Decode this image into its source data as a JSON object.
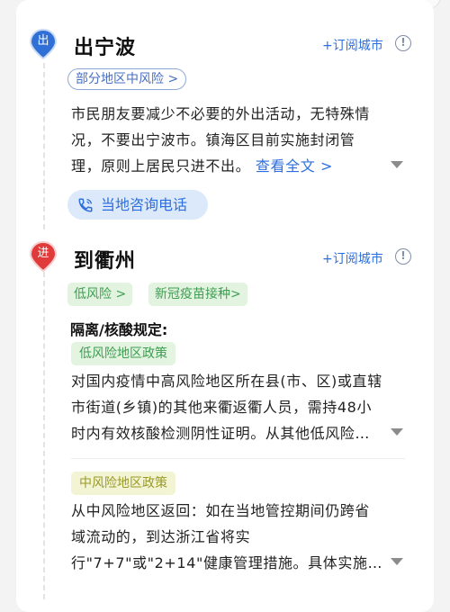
{
  "section1": {
    "badge": "出",
    "badge_color": "#2f6fd6",
    "title": "出宁波",
    "subscribe_label": "+订阅城市",
    "info_icon": "info-icon",
    "risk_tag": "部分地区中风险 >",
    "text_lines": [
      "市民朋友要减少不必要的外出活动，无特殊情",
      "况，不要出宁波市。镇海区目前实施封闭管",
      "理，原则上居民只进不出。"
    ],
    "view_full": "查看全文 >",
    "phone_button": "当地咨询电话",
    "phone_icon": "phone-icon"
  },
  "section2": {
    "badge": "进",
    "badge_color": "#e03a3a",
    "title": "到衢州",
    "subscribe_label": "+订阅城市",
    "info_icon": "info-icon",
    "tags": [
      "低风险 >",
      "新冠疫苗接种>"
    ],
    "rules_heading": "隔离/核酸规定:",
    "policies": [
      {
        "label": "低风险地区政策",
        "label_color": "#3f9d52",
        "lines": [
          "对国内疫情中高风险地区所在县(市、区)或直辖",
          "市街道(乡镇)的其他来衢返衢人员，需持48小",
          "时内有效核酸检测阴性证明。从其他低风险…"
        ]
      },
      {
        "label": "中风险地区政策",
        "label_color": "#9a9a2a",
        "lines": [
          "从中风险地区返回：如在当地管控期间仍跨省",
          "域流动的，到达浙江省将实",
          "行\"7+7\"或\"2+14\"健康管理措施。具体实施…"
        ]
      }
    ]
  }
}
